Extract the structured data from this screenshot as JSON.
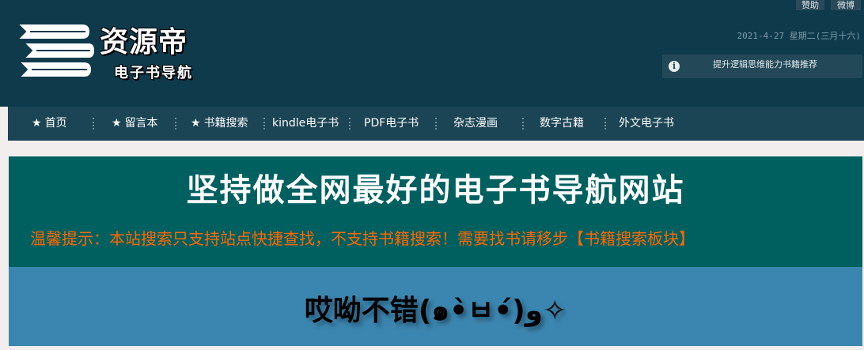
{
  "header": {
    "logo_title": "资源帝",
    "logo_subtitle": "电子书导航",
    "top_links": {
      "sponsor": "赞助",
      "weibo": "微博"
    },
    "date": "2021-4-27 星期二(三月十六)",
    "notice": {
      "icon": "info-circle-icon",
      "text": "提升逻辑思维能力书籍推荐"
    }
  },
  "nav": {
    "items": [
      {
        "label": "首页",
        "icon": "star-icon"
      },
      {
        "label": "留言本",
        "icon": "star-icon"
      },
      {
        "label": "书籍搜索",
        "icon": "star-icon"
      },
      {
        "label": "kindle电子书"
      },
      {
        "label": "PDF电子书"
      },
      {
        "label": "杂志漫画"
      },
      {
        "label": "数字古籍"
      },
      {
        "label": "外文电子书"
      }
    ],
    "star_glyph": "★"
  },
  "banner": {
    "title": "坚持做全网最好的电子书导航网站",
    "tip": "温馨提示：本站搜索只支持站点快捷查找，不支持书籍搜索！需要找书请移步【书籍搜索板块】"
  },
  "kaomoji": "哎呦不错(๑•̀ㅂ•́)و✧",
  "colors": {
    "header_bg": "#0e3a4c",
    "nav_bg": "#1b4454",
    "banner_bg": "#006060",
    "tip_color": "#ff6600",
    "kaomoji_bg": "#3b86b0"
  }
}
